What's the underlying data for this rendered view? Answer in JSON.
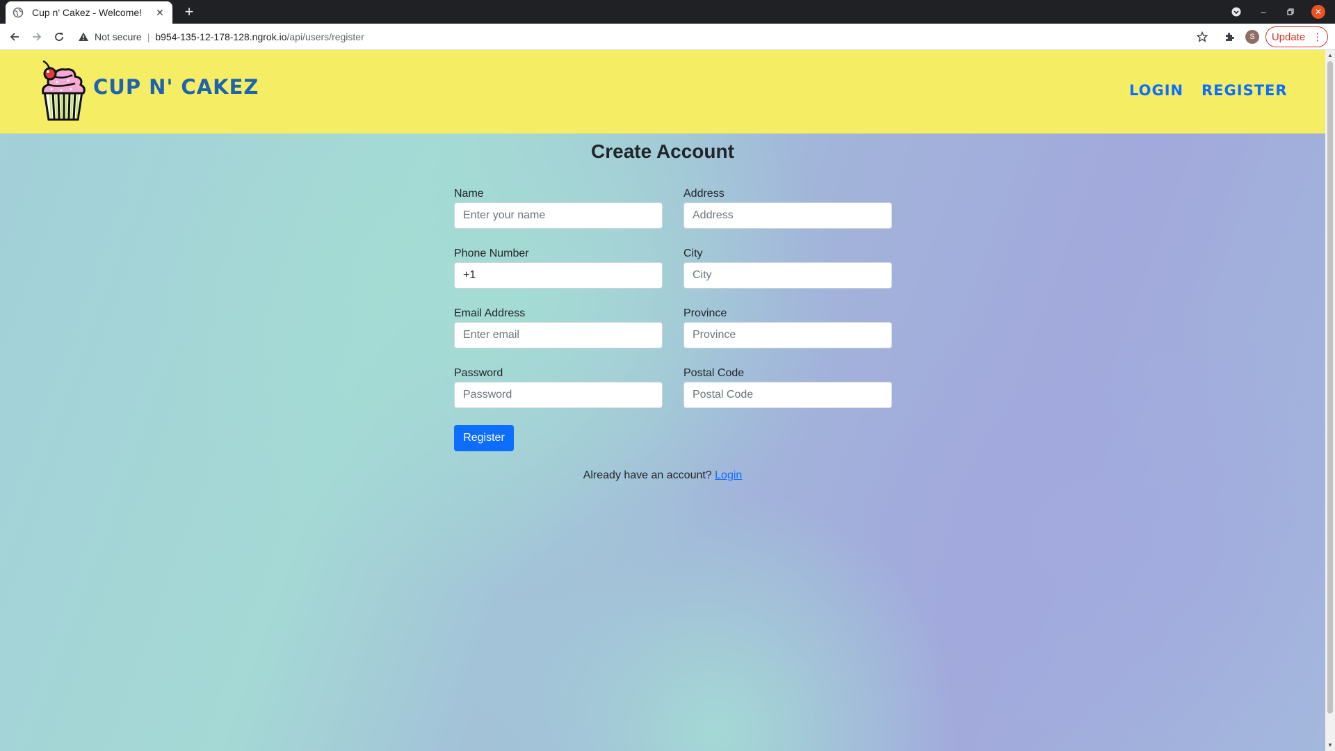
{
  "browser": {
    "tab_title": "Cup n' Cakez - Welcome!",
    "new_tab": "+",
    "not_secure": "Not secure",
    "url_host": "b954-135-12-178-128.ngrok.io",
    "url_path": "/api/users/register",
    "profile_initial": "S",
    "update_label": "Update",
    "accent_color": "#d93025"
  },
  "header": {
    "brand": "CUP N' CAKEZ",
    "nav": {
      "login": "LOGIN",
      "register": "REGISTER"
    },
    "bg_color": "#f5ee64",
    "link_color": "#0d6efd"
  },
  "form": {
    "title": "Create Account",
    "fields": {
      "name": {
        "label": "Name",
        "placeholder": "Enter your name",
        "value": ""
      },
      "address": {
        "label": "Address",
        "placeholder": "Address",
        "value": ""
      },
      "phone": {
        "label": "Phone Number",
        "placeholder": "",
        "value": "+1"
      },
      "city": {
        "label": "City",
        "placeholder": "City",
        "value": ""
      },
      "email": {
        "label": "Email Address",
        "placeholder": "Enter email",
        "value": ""
      },
      "province": {
        "label": "Province",
        "placeholder": "Province",
        "value": ""
      },
      "password": {
        "label": "Password",
        "placeholder": "Password",
        "value": ""
      },
      "postal": {
        "label": "Postal Code",
        "placeholder": "Postal Code",
        "value": ""
      }
    },
    "submit_label": "Register",
    "footer_text": "Already have an account?",
    "footer_link": "Login"
  }
}
